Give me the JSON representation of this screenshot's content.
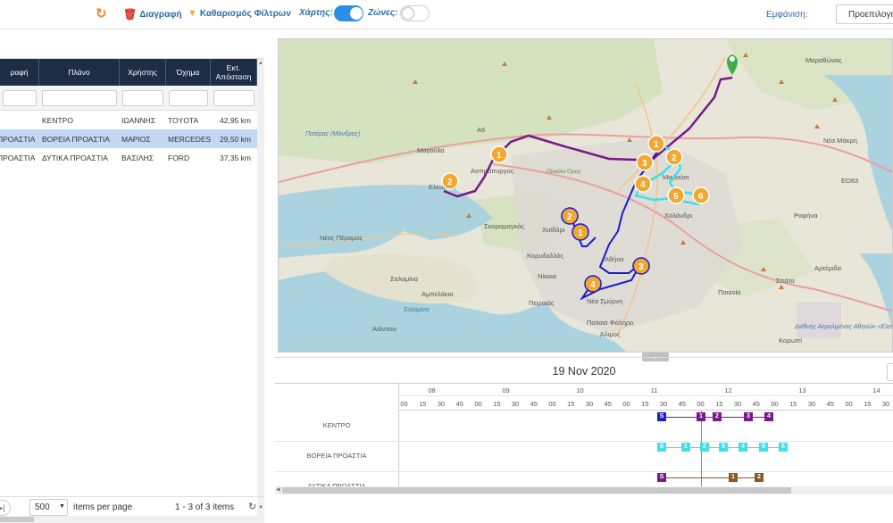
{
  "toolbar": {
    "refresh_icon": "refresh-icon",
    "delete_label": "Διαγραφή",
    "clear_filters_label": "Καθαρισμός Φίλτρων",
    "map_label": "Χάρτης:",
    "map_toggle": true,
    "zones_label": "Ζώνες:",
    "zones_toggle": false,
    "view_label": "Εμφάνιση:",
    "view_value": "Προεπιλογή"
  },
  "grid": {
    "headers": [
      "ραφή",
      "Πλάνο",
      "Χρήστης",
      "Όχημα",
      "Εκτ. Απόσταση"
    ],
    "rows": [
      {
        "c0": "",
        "plan": "ΚΕΝΤΡΟ",
        "user": "ΙΩΑΝΝΗΣ",
        "vehicle": "TOYOTA",
        "dist": "42,95 km"
      },
      {
        "c0": "ΠΡΟΑΣΤΙΑ",
        "plan": "ΒΟΡΕΙΑ ΠΡΟΑΣΤΙΑ",
        "user": "ΜΑΡΙΟΣ",
        "vehicle": "MERCEDES",
        "dist": "29,50 km"
      },
      {
        "c0": "ΠΡΟΑΣΤΙΑ",
        "plan": "ΔΥΤΙΚΑ ΠΡΟΑΣΤΙΑ",
        "user": "ΒΑΣΙΛΗΣ",
        "vehicle": "FORD",
        "dist": "37,35 km"
      }
    ],
    "selected_row": 1
  },
  "pager": {
    "page_size": "500",
    "items_per_page_label": "items per page",
    "count_label": "1 - 3 of 3 items"
  },
  "map": {
    "labels": [
      "Μαραθώνας",
      "Μαγούλα",
      "Ασπρόπυργος",
      "Ελευσίνα",
      "Νέα Μάκρη",
      "Μαρούσι",
      "Χαλάνδρι",
      "Ραφήνα",
      "Χαϊδάρι",
      "Σκαραμαγκάς",
      "Κορυδαλλός",
      "Αθήνα",
      "Νίκαια",
      "Αρτέμιδα",
      "Νέος Πέραμος",
      "Σαλαμίνα",
      "Αμπελάκια",
      "Πειραιάς",
      "Νέα Σμύρνη",
      "Παλαιό Φάληρο",
      "Άλιμος",
      "Αιάντειο",
      "Παιανία",
      "Σπάτα",
      "Κορωπί"
    ],
    "water_labels": [
      "Πατέρας (Μάνδρας)",
      "Σαλαμίνα"
    ],
    "park_labels": [
      "Ποικίλο Όρος"
    ],
    "airport_label": "Διεθνής Αερολιμένας Αθηνών «Ελευθέριος Βενιζέλος»",
    "road_label": "A6",
    "road_label_2": "EO83",
    "route_colors": {
      "kentro": "#1a1ad6",
      "voreia": "#3fe0e8",
      "dytika": "#7a1a8a"
    }
  },
  "timeline": {
    "date": "19 Nov 2020",
    "hours": [
      "08",
      "09",
      "10",
      "11",
      "12",
      "13",
      "14"
    ],
    "minutes": [
      "00",
      "15",
      "30",
      "45"
    ],
    "lanes": [
      "ΚΕΝΤΡΟ",
      "ΒΟΡΕΙΑ ΠΡΟΑΣΤΙΑ",
      "ΔΥΤΙΚΑ ΠΡΟΑΣΤΙΑ"
    ],
    "lane1_stops": [
      "S",
      "1",
      "2",
      "3",
      "4"
    ],
    "lane2_stops": [
      "S",
      "1",
      "2",
      "3",
      "4",
      "5",
      "6"
    ],
    "lane3_stops": [
      "S",
      "1",
      "2"
    ]
  }
}
